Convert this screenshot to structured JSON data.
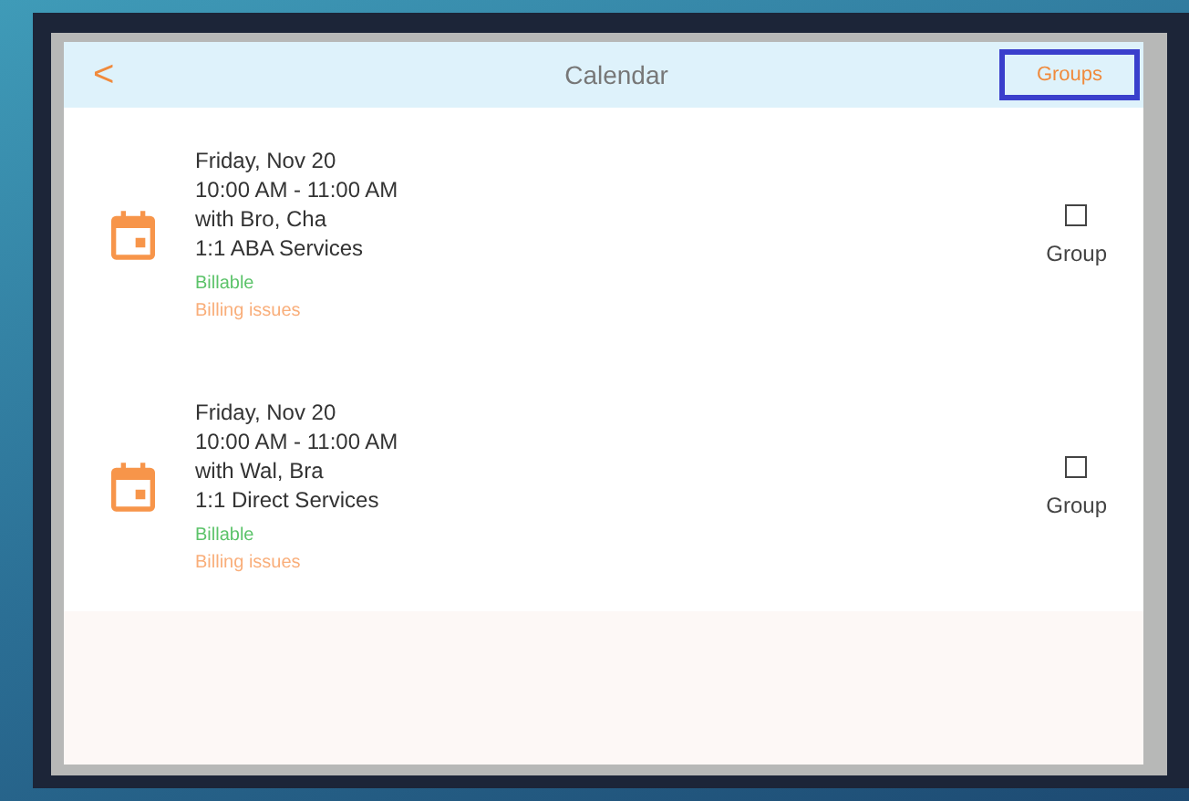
{
  "header": {
    "back": "<",
    "title": "Calendar",
    "action": "Groups"
  },
  "appointments": [
    {
      "date": "Friday, Nov 20",
      "time": "10:00 AM - 11:00 AM",
      "with": "with Bro, Cha",
      "service": "1:1 ABA Services",
      "billable": "Billable",
      "issues": "Billing issues",
      "group_label": "Group",
      "checked": false
    },
    {
      "date": "Friday, Nov 20",
      "time": "10:00 AM - 11:00 AM",
      "with": "with Wal, Bra",
      "service": "1:1 Direct Services",
      "billable": "Billable",
      "issues": "Billing issues",
      "group_label": "Group",
      "checked": false
    }
  ]
}
